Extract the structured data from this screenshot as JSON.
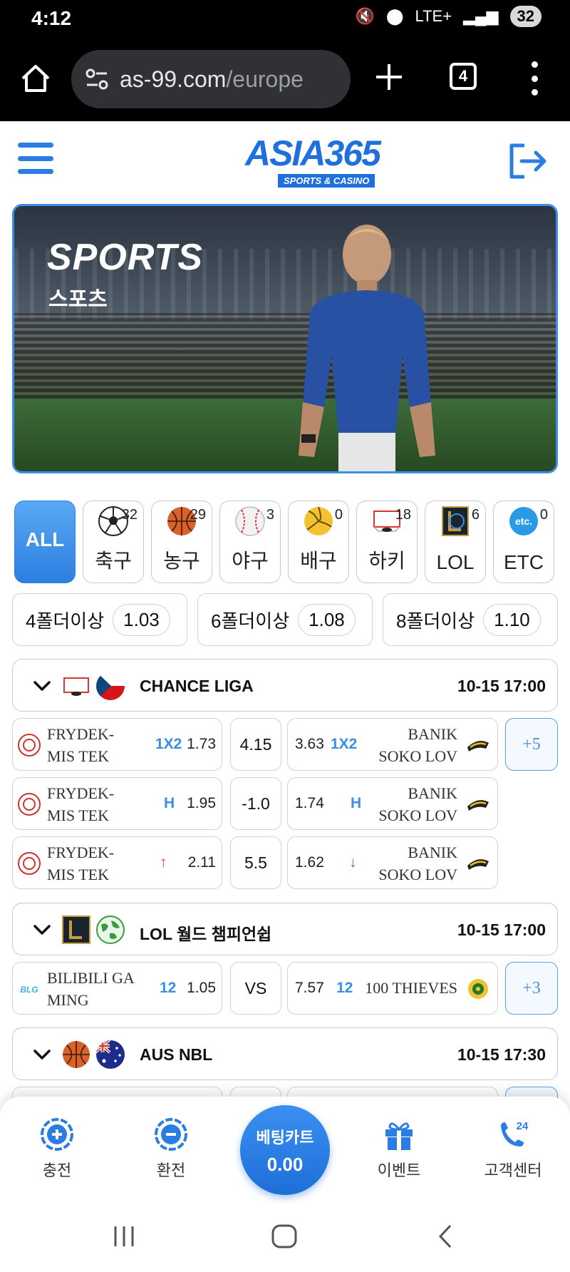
{
  "status_bar": {
    "time": "4:12",
    "network": "LTE+",
    "battery": "32"
  },
  "browser": {
    "url_domain": "as-99.com",
    "url_path": "/europe",
    "tab_count": "4"
  },
  "header": {
    "logo_text": "ASIA365",
    "logo_subtitle": "SPORTS & CASINO"
  },
  "banner": {
    "title": "SPORTS",
    "subtitle": "스포츠"
  },
  "sports": [
    {
      "label": "ALL",
      "count": "",
      "icon": "all-icon"
    },
    {
      "label": "축구",
      "count": "32",
      "icon": "soccer-ball-icon"
    },
    {
      "label": "농구",
      "count": "29",
      "icon": "basketball-icon"
    },
    {
      "label": "야구",
      "count": "3",
      "icon": "baseball-icon"
    },
    {
      "label": "배구",
      "count": "0",
      "icon": "volleyball-icon"
    },
    {
      "label": "하키",
      "count": "18",
      "icon": "hockey-icon"
    },
    {
      "label": "LOL",
      "count": "6",
      "icon": "lol-icon"
    },
    {
      "label": "ETC",
      "count": "0",
      "icon": "etc-icon"
    }
  ],
  "folder_bonus": [
    {
      "label": "4폴더이상",
      "value": "1.03"
    },
    {
      "label": "6폴더이상",
      "value": "1.08"
    },
    {
      "label": "8폴더이상",
      "value": "1.10"
    }
  ],
  "leagues": [
    {
      "name": "CHANCE LIGA",
      "time": "10-15 17:00",
      "more": "+5",
      "rows": [
        {
          "home": "FRYDEK-MIS TEK",
          "home_market": "1X2",
          "home_odds": "1.73",
          "mid": "4.15",
          "away_odds": "3.63",
          "away_market": "1X2",
          "away": "BANIK SOKO LOV"
        },
        {
          "home": "FRYDEK-MIS TEK",
          "home_market": "H",
          "home_odds": "1.95",
          "mid": "-1.0",
          "away_odds": "1.74",
          "away_market": "H",
          "away": "BANIK SOKO LOV"
        },
        {
          "home": "FRYDEK-MIS TEK",
          "home_market": "↑",
          "home_odds": "2.11",
          "mid": "5.5",
          "away_odds": "1.62",
          "away_market": "↓",
          "away": "BANIK SOKO LOV"
        }
      ]
    },
    {
      "name": "LOL 월드 챔피언쉽",
      "time": "10-15 17:00",
      "more": "+3",
      "rows": [
        {
          "home": "BILIBILI GA MING",
          "home_market": "12",
          "home_odds": "1.05",
          "mid": "VS",
          "away_odds": "7.57",
          "away_market": "12",
          "away": "100 THIEVES"
        }
      ]
    },
    {
      "name": "AUS NBL",
      "time": "10-15 17:30"
    }
  ],
  "bottom_nav": {
    "deposit": "충전",
    "withdraw": "환전",
    "betcart_label": "베팅카트",
    "betcart_value": "0.00",
    "event": "이벤트",
    "support": "고객센터",
    "support_badge": "24"
  },
  "colors": {
    "accent": "#2a7de1",
    "border": "#d2d2d2",
    "up": "#e04545"
  }
}
